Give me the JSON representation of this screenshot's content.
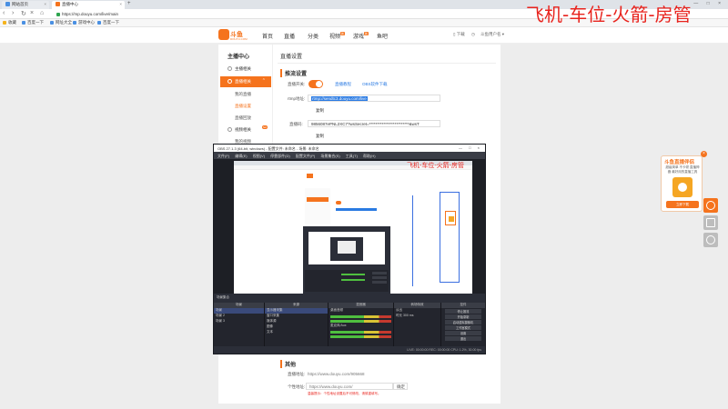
{
  "browser": {
    "tabs": [
      {
        "label": "网站首页",
        "active": false
      },
      {
        "label": "直播中心",
        "active": true
      }
    ],
    "new_tab": "+",
    "url": "https://mp.douyu.com/live/main",
    "bookmarks": [
      "收藏",
      "百度一下",
      "网址大全",
      "游戏中心",
      "百度一下"
    ],
    "right_hint": ""
  },
  "overlay_text": "飞机-车位-火箭-房管",
  "site": {
    "logo_text": "斗鱼",
    "logo_sub": "DOUYU.COM",
    "nav": [
      "首页",
      "直播",
      "分类",
      "视频",
      "游戏",
      "鱼吧"
    ],
    "nav_badges": {
      "视频": "新",
      "游戏": "新"
    },
    "header_right": [
      "下载",
      "历史",
      "斗鱼用户名"
    ]
  },
  "sidebar": {
    "title": "主播中心",
    "items": [
      {
        "label": "主播相关",
        "state": "plain"
      },
      {
        "label": "直播相关",
        "state": "active"
      },
      {
        "label": "我的直播",
        "state": "plain"
      },
      {
        "label": "直播设置",
        "state": "sub"
      },
      {
        "label": "直播回放",
        "state": "plain"
      },
      {
        "label": "视频相关",
        "state": "plain",
        "hot": "hot"
      },
      {
        "label": "我的视频",
        "state": "plain"
      }
    ]
  },
  "content": {
    "title": "直播设置",
    "section1": "推流设置",
    "toggle_label": "直播开关:",
    "toggle_on": true,
    "link1": "直播教程",
    "link2": "OBS软件下载",
    "rtmp_label": "rtmp地址:",
    "rtmp_value": "rtmp://sendtc3.douyu.com/live",
    "copy1": "复制",
    "code_label": "直播码:",
    "code_value": "9856087ePNL2XC7?wsSecret=*************************&wsT",
    "copy2": "复制"
  },
  "promo": {
    "title": "斗鱼直播伴侣",
    "desc": "超级简单 不卡顿 直播神器 最好用的直播工具",
    "button": "立即下载",
    "close": "×"
  },
  "obs": {
    "title": "OBS 27.1.3 (64-bit, windows) - 配置文件: 未命名 - 场景: 未命名",
    "window_buttons": "— □ ×",
    "menu": [
      "文件(F)",
      "编辑(E)",
      "视图(V)",
      "停靠部件(D)",
      "配置文件(P)",
      "场景集合(S)",
      "工具(T)",
      "帮助(H)"
    ],
    "scene_label": "场景集合",
    "panels": {
      "scenes": {
        "header": "场景",
        "rows": [
          "场景",
          "场景 2",
          "场景 3"
        ]
      },
      "sources": {
        "header": "来源",
        "rows": [
          "显示器采集",
          "窗口采集",
          "媒体源",
          "图像",
          "文本"
        ]
      },
      "mixer": {
        "header": "混音器",
        "rows": [
          "桌面音频",
          "麦克风/Aux"
        ]
      },
      "transitions": {
        "header": "转场特效",
        "rows": [
          "淡出",
          "时长 300 ms"
        ]
      },
      "controls": {
        "header": "控件",
        "rows": [
          "停止推流",
          "开始录制",
          "启动虚拟摄像机",
          "工作室模式",
          "设置",
          "退出"
        ]
      }
    },
    "status": "LIVE: 00:00:00   REC: 00:00:00   CPU: 1.2%, 30.00 fps"
  },
  "bottom": {
    "section": "其他",
    "label1": "直播地址:",
    "value1": "https://www.douyu.com/905668",
    "label2": "个性地址:",
    "value2": "https://www.douyu.com/",
    "suffix": "确定",
    "note": "温馨提示：个性地址设置后不可修改，请慎重填写。"
  },
  "colors": {
    "brand": "#f5731d",
    "link": "#2a7ae2",
    "overlay": "#e8231d",
    "obs_bg": "#2b2e38"
  }
}
